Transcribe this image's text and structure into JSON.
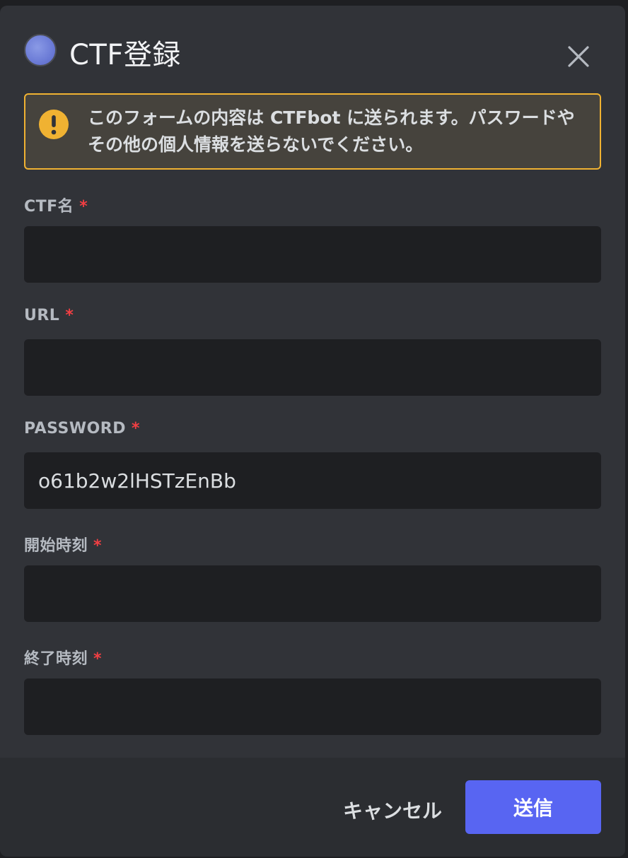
{
  "modal": {
    "title": "CTF登録",
    "close_icon": "close-icon",
    "avatar_color": "#6b7bd6"
  },
  "notice": {
    "icon": "warning-icon",
    "text": "このフォームの内容は CTFbot に送られます。パスワードやその他の個人情報を送らないでください。",
    "border_color": "#f0b232"
  },
  "fields": [
    {
      "label": "CTF名",
      "required_mark": "*",
      "value": "",
      "placeholder": ""
    },
    {
      "label": "URL",
      "required_mark": "*",
      "value": "",
      "placeholder": ""
    },
    {
      "label": "PASSWORD",
      "required_mark": "*",
      "value": "o61b2w2lHSTzEnBb",
      "placeholder": ""
    },
    {
      "label": "開始時刻",
      "required_mark": "*",
      "value": "",
      "placeholder": ""
    },
    {
      "label": "終了時刻",
      "required_mark": "*",
      "value": "",
      "placeholder": ""
    }
  ],
  "footer": {
    "cancel_label": "キャンセル",
    "submit_label": "送信",
    "submit_color": "#5865f2"
  }
}
